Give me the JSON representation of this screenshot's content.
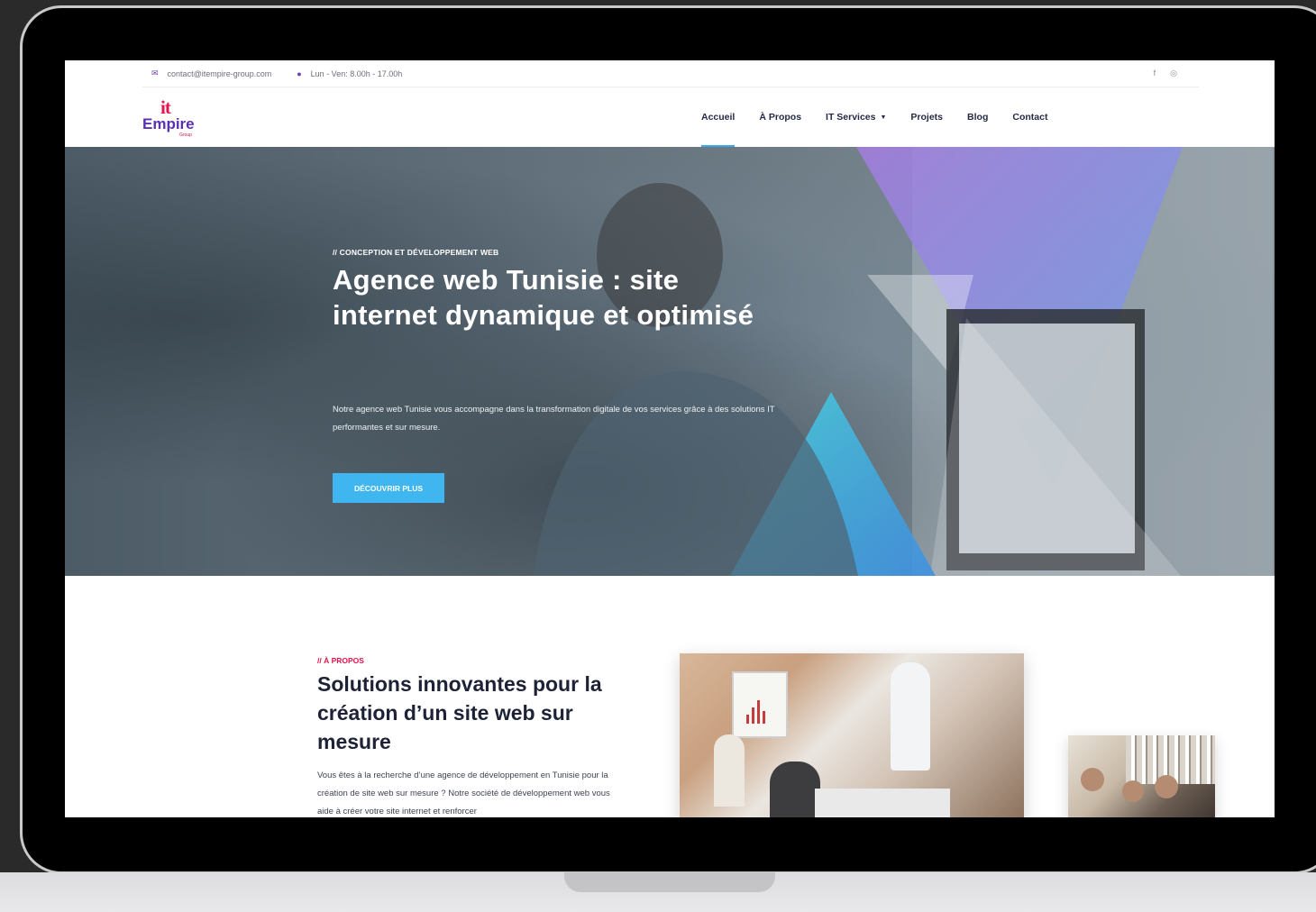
{
  "topbar": {
    "email": "contact@itempire-group.com",
    "email_icon": "envelope-icon",
    "hours": "Lun - Ven: 8.00h - 17.00h",
    "hours_icon": "clock-icon",
    "social": [
      {
        "name": "facebook-icon",
        "glyph": "f"
      },
      {
        "name": "instagram-icon",
        "glyph": "◎"
      }
    ]
  },
  "logo": {
    "mark": "it",
    "name": "Empire",
    "sub": "Group"
  },
  "nav": {
    "items": [
      {
        "label": "Accueil",
        "active": true
      },
      {
        "label": "À Propos",
        "active": false
      },
      {
        "label": "IT Services",
        "active": false,
        "dropdown": true
      },
      {
        "label": "Projets",
        "active": false
      },
      {
        "label": "Blog",
        "active": false
      },
      {
        "label": "Contact",
        "active": false
      }
    ]
  },
  "hero": {
    "eyebrow": "// CONCEPTION ET DÉVELOPPEMENT WEB",
    "title": "Agence web Tunisie : site internet dynamique et optimisé",
    "lead": "Notre agence web Tunisie vous accompagne dans la transformation digitale de vos services grâce à des solutions IT performantes et sur mesure.",
    "cta": "DÉCOUVRIR PLUS"
  },
  "about": {
    "eyebrow": "// À PROPOS",
    "title": "Solutions innovantes pour la création d’un site web sur mesure",
    "paragraph": "Vous êtes à la recherche d’une agence de développement en Tunisie pour la création de site web sur mesure ? Notre société de développement web vous aide à créer votre site internet et renforcer"
  },
  "colors": {
    "accent_blue": "#3fb6f0",
    "brand_red": "#e3144e",
    "brand_purple": "#5b2fb5",
    "heading_dark": "#1d2236"
  }
}
